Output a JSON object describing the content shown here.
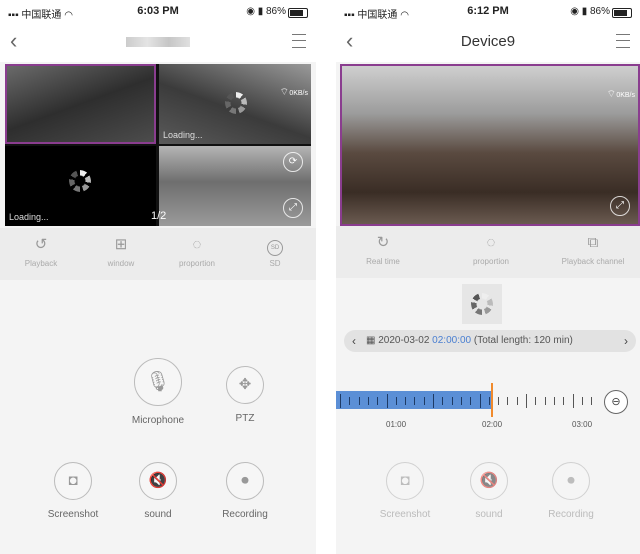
{
  "left": {
    "status": {
      "carrier": "中国联通",
      "time": "6:03 PM",
      "battery": "86%"
    },
    "title": "",
    "tiles": [
      {
        "loading": ""
      },
      {
        "loading": "Loading..."
      },
      {
        "loading": "Loading..."
      },
      {
        "loading": ""
      }
    ],
    "wifi_rate": "0KB/s",
    "page_indicator": "1/2",
    "toolbar": [
      "Playback",
      "window",
      "proportion",
      "SD"
    ],
    "controls": {
      "microphone": "Microphone",
      "ptz": "PTZ",
      "screenshot": "Screenshot",
      "sound": "sound",
      "recording": "Recording"
    }
  },
  "right": {
    "status": {
      "carrier": "中国联通",
      "time": "6:12 PM",
      "battery": "86%"
    },
    "title": "Device9",
    "wifi_rate": "0KB/s",
    "toolbar": [
      "Real time",
      "proportion",
      "Playback channel"
    ],
    "date": {
      "date": "2020-03-02",
      "time": "02:00:00",
      "length": "(Total length: 120 min)"
    },
    "timeline": {
      "labels": [
        "01:00",
        "02:00",
        "03:00"
      ],
      "cursor": "02:00"
    },
    "controls": {
      "screenshot": "Screenshot",
      "sound": "sound",
      "recording": "Recording"
    }
  },
  "icons": [
    "back-icon",
    "menu-icon",
    "playback-icon",
    "window-icon",
    "proportion-icon",
    "sd-icon",
    "microphone-icon",
    "ptz-icon",
    "screenshot-icon",
    "sound-icon",
    "recording-icon",
    "calendar-icon",
    "zoom-out-icon",
    "loading-spinner-icon"
  ]
}
